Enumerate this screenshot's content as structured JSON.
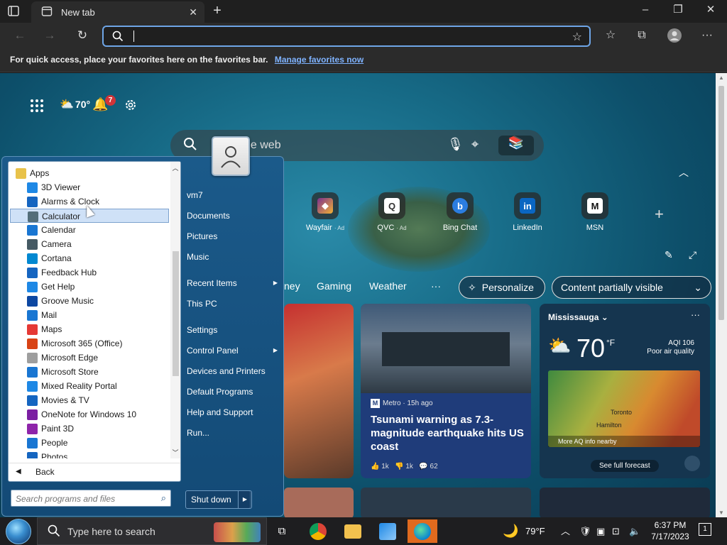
{
  "browser": {
    "tab_title": "New tab",
    "address_placeholder": "",
    "favorites_message": "For quick access, place your favorites here on the favorites bar.",
    "favorites_link": "Manage favorites now"
  },
  "ntp": {
    "weather_temp": "70°",
    "notification_count": "7",
    "search_placeholder": "he web",
    "quick_links": [
      {
        "label": "Wayfair",
        "ad": "· Ad",
        "glyph": "W"
      },
      {
        "label": "QVC",
        "ad": "· Ad",
        "glyph": "Q"
      },
      {
        "label": "Bing Chat",
        "ad": "",
        "glyph": "b"
      },
      {
        "label": "LinkedIn",
        "ad": "",
        "glyph": "in"
      },
      {
        "label": "MSN",
        "ad": "",
        "glyph": "M"
      }
    ],
    "feed_tabs": [
      "ney",
      "Gaming",
      "Weather",
      "···"
    ],
    "personalize": "Personalize",
    "content_visibility": "Content partially visible",
    "news_card": {
      "source": "Metro · 15h ago",
      "source_logo": "M",
      "headline": "Tsunami warning as 7.3-magnitude earthquake hits US coast",
      "likes": "1k",
      "dislikes": "1k",
      "comments": "62"
    },
    "weather_card": {
      "city": "Mississauga",
      "temp": "70",
      "unit": "°F",
      "aqi": "AQI 106",
      "aqi_desc": "Poor air quality",
      "map_city_1": "Toronto",
      "map_city_2": "Hamilton",
      "map_foot": "More AQ info nearby",
      "forecast": "See full forecast"
    }
  },
  "start_menu": {
    "programs_header": "Apps",
    "programs": [
      {
        "label": "3D Viewer",
        "color": "#1e88e5"
      },
      {
        "label": "Alarms & Clock",
        "color": "#1565c0"
      },
      {
        "label": "Calculator",
        "color": "#546e7a"
      },
      {
        "label": "Calendar",
        "color": "#1976d2"
      },
      {
        "label": "Camera",
        "color": "#455a64"
      },
      {
        "label": "Cortana",
        "color": "#0288d1"
      },
      {
        "label": "Feedback Hub",
        "color": "#1565c0"
      },
      {
        "label": "Get Help",
        "color": "#1e88e5"
      },
      {
        "label": "Groove Music",
        "color": "#0d47a1"
      },
      {
        "label": "Mail",
        "color": "#1976d2"
      },
      {
        "label": "Maps",
        "color": "#e53935"
      },
      {
        "label": "Microsoft 365 (Office)",
        "color": "#d84315"
      },
      {
        "label": "Microsoft Edge",
        "color": "#9e9e9e"
      },
      {
        "label": "Microsoft Store",
        "color": "#1976d2"
      },
      {
        "label": "Mixed Reality Portal",
        "color": "#1e88e5"
      },
      {
        "label": "Movies & TV",
        "color": "#1565c0"
      },
      {
        "label": "OneNote for Windows 10",
        "color": "#7b1fa2"
      },
      {
        "label": "Paint 3D",
        "color": "#8e24aa"
      },
      {
        "label": "People",
        "color": "#1976d2"
      },
      {
        "label": "Photos",
        "color": "#1565c0"
      }
    ],
    "back_label": "Back",
    "search_placeholder": "Search programs and files",
    "places": [
      "vm7",
      "Documents",
      "Pictures",
      "Music",
      "Recent Items",
      "This PC",
      "Settings",
      "Control Panel",
      "Devices and Printers",
      "Default Programs",
      "Help and Support",
      "Run..."
    ],
    "shutdown_label": "Shut down"
  },
  "taskbar": {
    "search_placeholder": "Type here to search",
    "weather_temp": "79°F",
    "time": "6:37 PM",
    "date": "7/17/2023",
    "notification_count": "1"
  }
}
